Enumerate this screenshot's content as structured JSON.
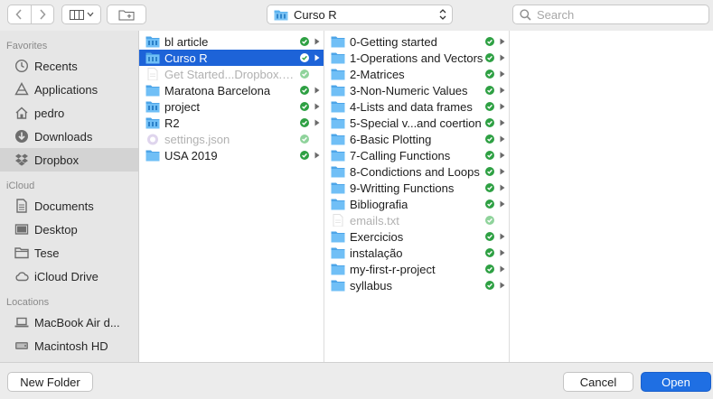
{
  "toolbar": {
    "location": "Curso R",
    "search_placeholder": "Search"
  },
  "sidebar": {
    "favorites_header": "Favorites",
    "favorites": [
      {
        "label": "Recents",
        "icon": "clock-icon"
      },
      {
        "label": "Applications",
        "icon": "applications-icon"
      },
      {
        "label": "pedro",
        "icon": "home-icon"
      },
      {
        "label": "Downloads",
        "icon": "downloads-icon"
      },
      {
        "label": "Dropbox",
        "icon": "dropbox-icon",
        "selected": true
      }
    ],
    "icloud_header": "iCloud",
    "icloud": [
      {
        "label": "Documents",
        "icon": "document-icon"
      },
      {
        "label": "Desktop",
        "icon": "desktop-icon"
      },
      {
        "label": "Tese",
        "icon": "folder-outline-icon"
      },
      {
        "label": "iCloud Drive",
        "icon": "cloud-icon"
      }
    ],
    "locations_header": "Locations",
    "locations": [
      {
        "label": "MacBook Air d...",
        "icon": "laptop-icon"
      },
      {
        "label": "Macintosh HD",
        "icon": "disk-icon"
      }
    ]
  },
  "columns": {
    "col1": [
      {
        "label": "bl article",
        "type": "folder-app",
        "synced": true,
        "arrow": true
      },
      {
        "label": "Curso R",
        "type": "folder-app",
        "synced": true,
        "arrow": true,
        "selected": true
      },
      {
        "label": "Get Started...Dropbox.pdf",
        "type": "file",
        "synced": true,
        "dim": true
      },
      {
        "label": "Maratona Barcelona",
        "type": "folder",
        "synced": true,
        "arrow": true
      },
      {
        "label": "project",
        "type": "folder-app",
        "synced": true,
        "arrow": true
      },
      {
        "label": "R2",
        "type": "folder-app",
        "synced": true,
        "arrow": true
      },
      {
        "label": "settings.json",
        "type": "json",
        "synced": true,
        "dim": true
      },
      {
        "label": "USA 2019",
        "type": "folder",
        "synced": true,
        "arrow": true
      }
    ],
    "col2": [
      {
        "label": "0-Getting started",
        "type": "folder",
        "synced": true,
        "arrow": true
      },
      {
        "label": "1-Operations and Vectors",
        "type": "folder",
        "synced": true,
        "arrow": true
      },
      {
        "label": "2-Matrices",
        "type": "folder",
        "synced": true,
        "arrow": true
      },
      {
        "label": "3-Non-Numeric Values",
        "type": "folder",
        "synced": true,
        "arrow": true
      },
      {
        "label": "4-Lists and data frames",
        "type": "folder",
        "synced": true,
        "arrow": true
      },
      {
        "label": "5-Special v...and coertion",
        "type": "folder",
        "synced": true,
        "arrow": true
      },
      {
        "label": "6-Basic Plotting",
        "type": "folder",
        "synced": true,
        "arrow": true
      },
      {
        "label": "7-Calling Functions",
        "type": "folder",
        "synced": true,
        "arrow": true
      },
      {
        "label": "8-Condictions and Loops",
        "type": "folder",
        "synced": true,
        "arrow": true
      },
      {
        "label": "9-Writting Functions",
        "type": "folder",
        "synced": true,
        "arrow": true
      },
      {
        "label": "Bibliografia",
        "type": "folder",
        "synced": true,
        "arrow": true
      },
      {
        "label": "emails.txt",
        "type": "file",
        "synced": true,
        "dim": true
      },
      {
        "label": "Exercicios",
        "type": "folder",
        "synced": true,
        "arrow": true
      },
      {
        "label": "instalação",
        "type": "folder",
        "synced": true,
        "arrow": true
      },
      {
        "label": "my-first-r-project",
        "type": "folder",
        "synced": true,
        "arrow": true
      },
      {
        "label": "syllabus",
        "type": "folder",
        "synced": true,
        "arrow": true
      }
    ]
  },
  "footer": {
    "new_folder": "New Folder",
    "cancel": "Cancel",
    "open": "Open"
  },
  "colors": {
    "selection": "#1d63d8",
    "folder": "#5ab3f0",
    "sync_green": "#2ea043",
    "open_button": "#1f6fe3"
  }
}
